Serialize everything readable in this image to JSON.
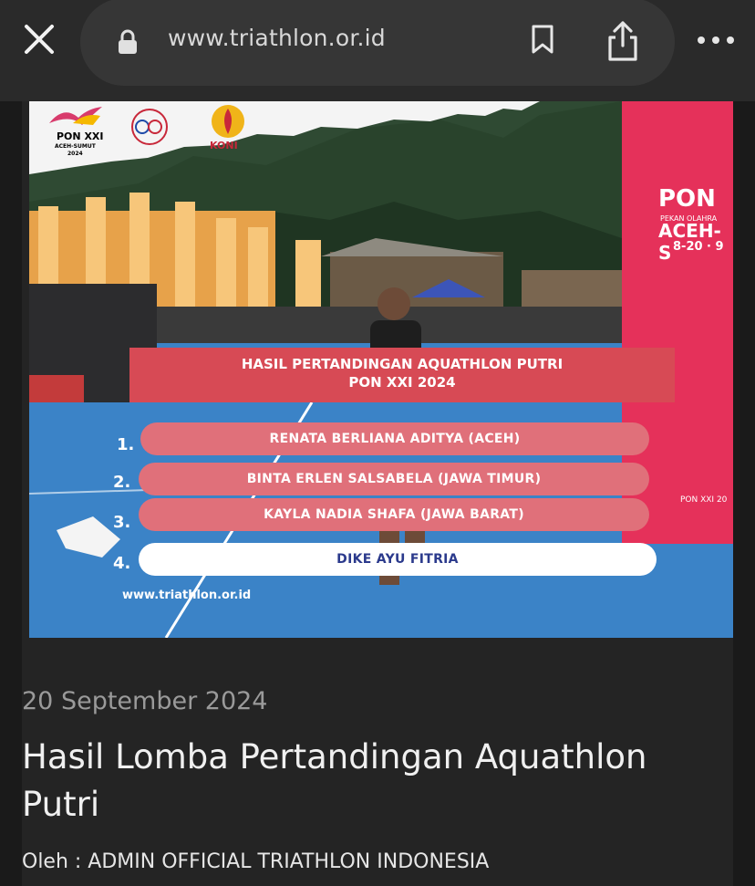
{
  "browser": {
    "url": "www.triathlon.or.id",
    "icons": [
      "close-icon",
      "lock-icon",
      "bookmark-icon",
      "share-icon",
      "more-icon"
    ]
  },
  "hero": {
    "banner_line1": "HASIL PERTANDINGAN AQUATHLON PUTRI",
    "banner_line2": "PON XXI 2024",
    "results": [
      {
        "rank": "1.",
        "name": "RENATA BERLIANA ADITYA (ACEH)"
      },
      {
        "rank": "2.",
        "name": "BINTA ERLEN SALSABELA (JAWA TIMUR)"
      },
      {
        "rank": "3.",
        "name": "KAYLA NADIA SHAFA (JAWA BARAT)"
      },
      {
        "rank": "4.",
        "name": "DIKE AYU FITRIA"
      }
    ],
    "website": "www.triathlon.or.id",
    "logo_pon": "PON XXI",
    "logo_pon_sub": "ACEH-SUMUT",
    "logo_pon_year": "2024",
    "logo_koni": "KONI",
    "sign_pon": "PON",
    "sign_sub": "PEKAN OLAHRA",
    "sign_aceh": "ACEH-S",
    "sign_date": "8-20 · 9",
    "sign_small": "PON XXI 20"
  },
  "article": {
    "date": "20 September 2024",
    "title": "Hasil Lomba Pertandingan Aquathlon Putri",
    "author": "Oleh : ADMIN OFFICIAL TRIATHLON INDONESIA"
  },
  "colors": {
    "banner": "#d74a55",
    "pill": "#e0707a",
    "track": "#3b83c7",
    "pon_sign": "#e5315a"
  }
}
